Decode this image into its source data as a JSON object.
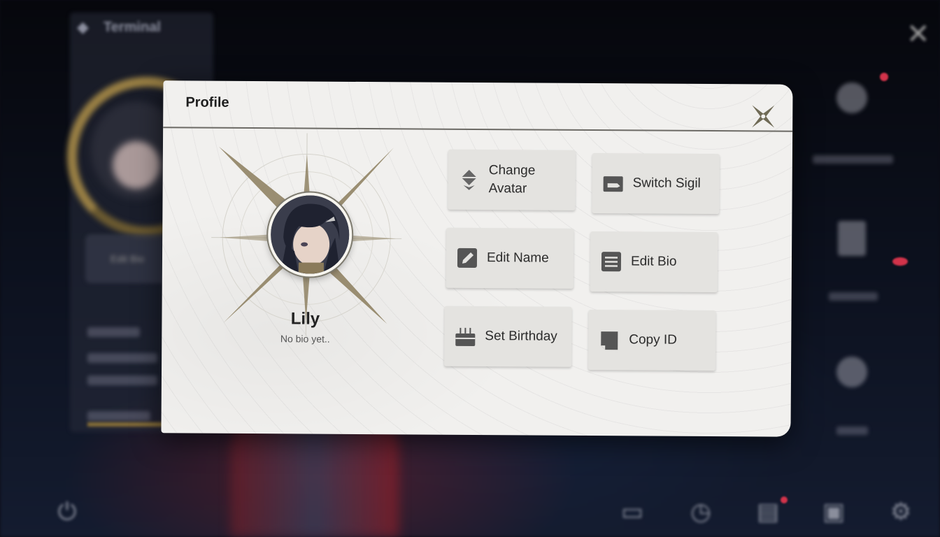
{
  "background": {
    "terminal_label": "Terminal",
    "edit_bio_label": "Edit Bio"
  },
  "modal": {
    "title": "Profile",
    "close_icon": "close-x-icon"
  },
  "profile": {
    "name": "Lily",
    "bio": "No bio yet.."
  },
  "actions": [
    {
      "id": "change-avatar",
      "label": "Change Avatar",
      "icon": "diamond-arrows-icon"
    },
    {
      "id": "switch-sigil",
      "label": "Switch Sigil",
      "icon": "card-icon"
    },
    {
      "id": "edit-name",
      "label": "Edit Name",
      "icon": "pencil-icon"
    },
    {
      "id": "edit-bio",
      "label": "Edit Bio",
      "icon": "lines-icon"
    },
    {
      "id": "set-birthday",
      "label": "Set Birthday",
      "icon": "cake-icon"
    },
    {
      "id": "copy-id",
      "label": "Copy ID",
      "icon": "copy-icon"
    }
  ],
  "colors": {
    "modal_bg": "#f1f0ee",
    "button_bg": "#e4e3e0",
    "icon": "#4a4a4a",
    "accent_gold": "#8b7d5c"
  }
}
